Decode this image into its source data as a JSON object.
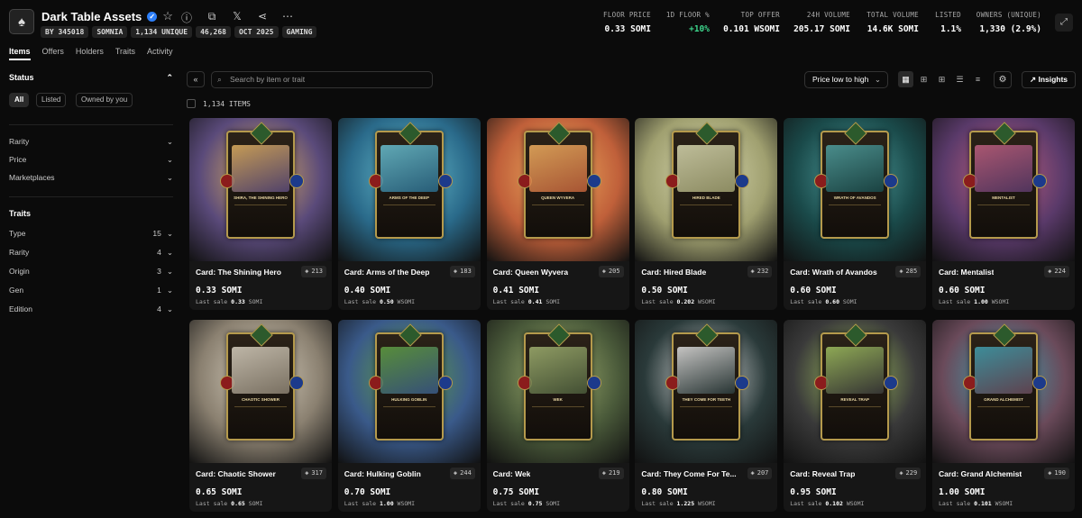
{
  "header": {
    "title": "Dark Table Assets",
    "chips": [
      "BY 345018",
      "SOMNIA",
      "1,134 UNIQUE",
      "46,268",
      "OCT 2025",
      "GAMING"
    ],
    "stats": [
      {
        "label": "FLOOR PRICE",
        "value": "0.33 SOMI"
      },
      {
        "label": "1D FLOOR %",
        "value": "+10%"
      },
      {
        "label": "TOP OFFER",
        "value": "0.101 WSOMI"
      },
      {
        "label": "24H VOLUME",
        "value": "205.17 SOMI"
      },
      {
        "label": "TOTAL VOLUME",
        "value": "14.6K SOMI"
      },
      {
        "label": "LISTED",
        "value": "1.1%"
      },
      {
        "label": "OWNERS (UNIQUE)",
        "value": "1,330 (2.9%)"
      }
    ],
    "colors": {
      "positive": "#3dd68c",
      "verified": "#2d7ff9"
    }
  },
  "tabs": [
    "Items",
    "Offers",
    "Holders",
    "Traits",
    "Activity"
  ],
  "sidebar": {
    "status_label": "Status",
    "status_buttons": [
      "All",
      "Listed",
      "Owned by you"
    ],
    "filters": [
      "Rarity",
      "Price",
      "Marketplaces"
    ],
    "traits_label": "Traits",
    "traits": [
      {
        "name": "Type",
        "count": "15"
      },
      {
        "name": "Rarity",
        "count": "4"
      },
      {
        "name": "Origin",
        "count": "3"
      },
      {
        "name": "Gen",
        "count": "1"
      },
      {
        "name": "Edition",
        "count": "4"
      }
    ]
  },
  "toolbar": {
    "search_placeholder": "Search by item or trait",
    "sort_label": "Price low to high",
    "insights_label": "Insights",
    "item_count": "1,134 ITEMS"
  },
  "cards": [
    {
      "name": "Card: The Shining Hero",
      "views": "213",
      "price": "0.33 SOMI",
      "last_label": "Last sale",
      "last_value": "0.33",
      "last_unit": "SOMI",
      "art_name": "SHIRA, THE SHINING HERO",
      "bg": "#5a4a7a",
      "accent": "#e0b060"
    },
    {
      "name": "Card: Arms of the Deep",
      "views": "183",
      "price": "0.40 SOMI",
      "last_label": "Last sale",
      "last_value": "0.50",
      "last_unit": "WSOMI",
      "art_name": "ARMS OF THE DEEP",
      "bg": "#2a6a8a",
      "accent": "#6ac0d0"
    },
    {
      "name": "Card: Queen Wyvera",
      "views": "205",
      "price": "0.41 SOMI",
      "last_label": "Last sale",
      "last_value": "0.41",
      "last_unit": "SOMI",
      "art_name": "QUEEN WYVERA",
      "bg": "#c0603a",
      "accent": "#f0b060"
    },
    {
      "name": "Card: Hired Blade",
      "views": "232",
      "price": "0.50 SOMI",
      "last_label": "Last sale",
      "last_value": "0.202",
      "last_unit": "WSOMI",
      "art_name": "HIRED BLADE",
      "bg": "#a0a070",
      "accent": "#d8d8b0"
    },
    {
      "name": "Card: Wrath of Avandos",
      "views": "285",
      "price": "0.60 SOMI",
      "last_label": "Last sale",
      "last_value": "0.60",
      "last_unit": "SOMI",
      "art_name": "WRATH OF AVANDOS",
      "bg": "#1a4a4a",
      "accent": "#50a0a0"
    },
    {
      "name": "Card: Mentalist",
      "views": "224",
      "price": "0.60 SOMI",
      "last_label": "Last sale",
      "last_value": "1.00",
      "last_unit": "WSOMI",
      "art_name": "MENTALIST",
      "bg": "#5a3a6a",
      "accent": "#c06080"
    },
    {
      "name": "Card: Chaotic Shower",
      "views": "317",
      "price": "0.65 SOMI",
      "last_label": "Last sale",
      "last_value": "0.65",
      "last_unit": "SOMI",
      "art_name": "CHAOTIC SHOWER",
      "bg": "#8a8070",
      "accent": "#d8d0c0"
    },
    {
      "name": "Card: Hulking Goblin",
      "views": "244",
      "price": "0.70 SOMI",
      "last_label": "Last sale",
      "last_value": "1.00",
      "last_unit": "WSOMI",
      "art_name": "HULKING GOBLIN",
      "bg": "#3a5a8a",
      "accent": "#60a040"
    },
    {
      "name": "Card: Wek",
      "views": "219",
      "price": "0.75 SOMI",
      "last_label": "Last sale",
      "last_value": "0.75",
      "last_unit": "SOMI",
      "art_name": "WEK",
      "bg": "#4a5a3a",
      "accent": "#a0b070"
    },
    {
      "name": "Card: They Come For Te...",
      "views": "207",
      "price": "0.80 SOMI",
      "last_label": "Last sale",
      "last_value": "1.225",
      "last_unit": "WSOMI",
      "art_name": "THEY COME FOR TEETH",
      "bg": "#2a3a3a",
      "accent": "#e0e0e0"
    },
    {
      "name": "Card: Reveal Trap",
      "views": "229",
      "price": "0.95 SOMI",
      "last_label": "Last sale",
      "last_value": "0.102",
      "last_unit": "WSOMI",
      "art_name": "REVEAL TRAP",
      "bg": "#3a3a3a",
      "accent": "#a0c060"
    },
    {
      "name": "Card: Grand Alchemist",
      "views": "190",
      "price": "1.00 SOMI",
      "last_label": "Last sale",
      "last_value": "0.101",
      "last_unit": "WSOMI",
      "art_name": "GRAND ALCHEMIST",
      "bg": "#6a4a5a",
      "accent": "#40a0b0"
    }
  ]
}
